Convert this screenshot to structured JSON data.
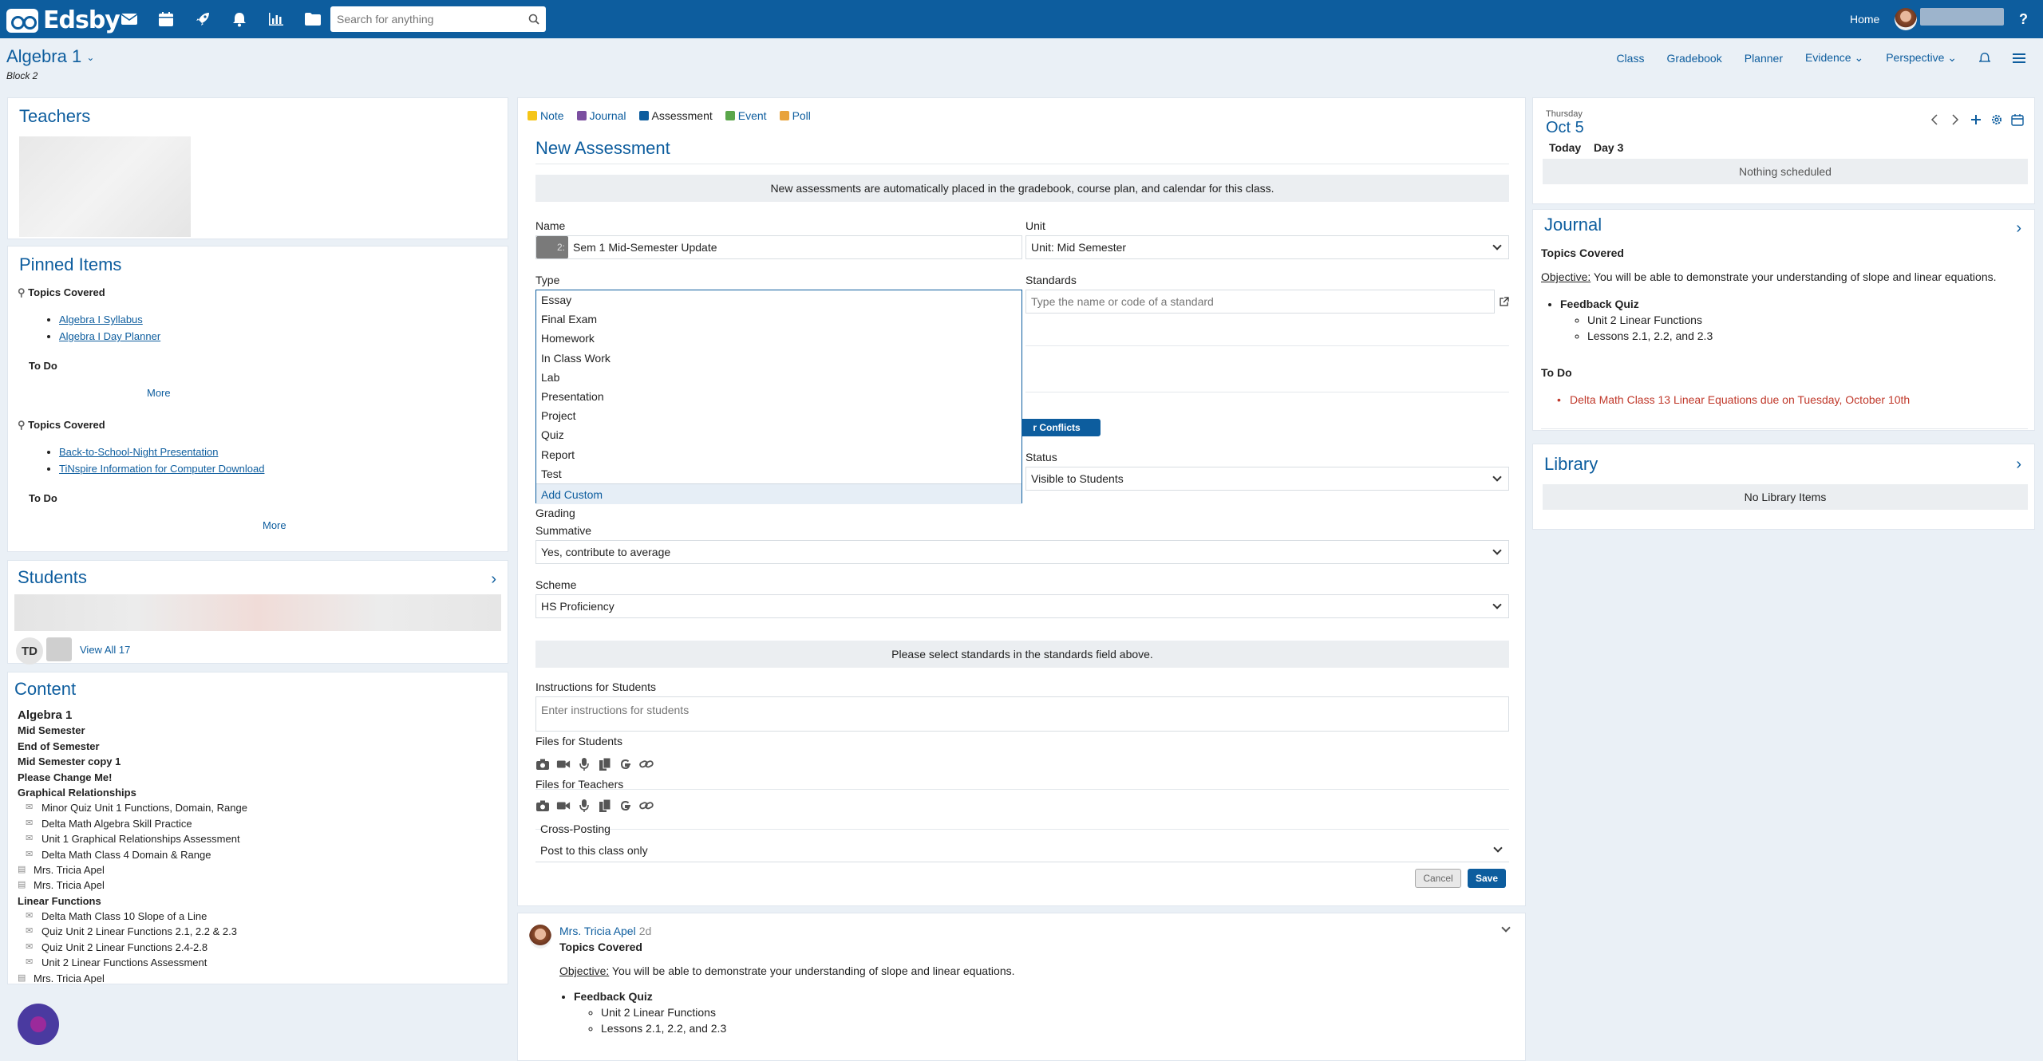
{
  "app": {
    "name": "Edsby"
  },
  "topbar": {
    "icons": [
      "mail-icon",
      "calendar-icon",
      "rocket-icon",
      "bell-icon",
      "chart-icon",
      "folder-icon"
    ],
    "search_placeholder": "Search for anything",
    "home_label": "Home",
    "help_label": "?"
  },
  "class": {
    "title": "Algebra 1",
    "block": "Block 2"
  },
  "classnav": {
    "class": "Class",
    "gradebook": "Gradebook",
    "planner": "Planner",
    "evidence": "Evidence",
    "perspective": "Perspective"
  },
  "teachers": {
    "title": "Teachers"
  },
  "pinned": {
    "title": "Pinned Items",
    "groups": [
      {
        "heading": "Topics Covered",
        "links": [
          "Algebra I Syllabus",
          "Algebra I Day Planner"
        ],
        "todo": "To Do",
        "more": "More"
      },
      {
        "heading": "Topics Covered",
        "links": [
          "Back-to-School-Night Presentation",
          "TiNspire Information for Computer Download"
        ],
        "todo": "To Do",
        "more": "More"
      }
    ]
  },
  "students": {
    "title": "Students",
    "badge": "TD",
    "view_all": "View All 17"
  },
  "content": {
    "title": "Content",
    "items": [
      {
        "text": "Algebra 1",
        "level": 0,
        "big": true
      },
      {
        "text": "Mid Semester",
        "level": 0
      },
      {
        "text": "End of Semester",
        "level": 0
      },
      {
        "text": "Mid Semester copy 1",
        "level": 0
      },
      {
        "text": "Please Change Me!",
        "level": 0
      },
      {
        "text": "Graphical Relationships",
        "level": 0
      },
      {
        "text": "Minor Quiz Unit 1 Functions, Domain, Range",
        "level": 2
      },
      {
        "text": "Delta Math Algebra Skill Practice",
        "level": 2
      },
      {
        "text": "Unit 1 Graphical Relationships Assessment",
        "level": 2
      },
      {
        "text": "Delta Math Class 4 Domain & Range",
        "level": 2
      },
      {
        "text": "Mrs. Tricia Apel",
        "level": 1
      },
      {
        "text": "Mrs. Tricia Apel",
        "level": 1
      },
      {
        "text": "Linear Functions",
        "level": 0
      },
      {
        "text": "Delta Math Class 10 Slope of a Line",
        "level": 2
      },
      {
        "text": "Quiz Unit 2 Linear Functions 2.1, 2.2 & 2.3",
        "level": 2
      },
      {
        "text": "Quiz Unit 2 Linear Functions 2.4-2.8",
        "level": 2
      },
      {
        "text": "Unit 2 Linear Functions Assessment",
        "level": 2
      },
      {
        "text": "Mrs. Tricia Apel",
        "level": 1
      }
    ]
  },
  "post_types": [
    {
      "label": "Note",
      "color": "#f5c518"
    },
    {
      "label": "Journal",
      "color": "#7b4fa0"
    },
    {
      "label": "Assessment",
      "color": "#0d5d9e",
      "active": true
    },
    {
      "label": "Event",
      "color": "#5aa64a"
    },
    {
      "label": "Poll",
      "color": "#e8a33c"
    }
  ],
  "form": {
    "title": "New Assessment",
    "info": "New assessments are automatically placed in the gradebook, course plan, and calendar for this class.",
    "name_label": "Name",
    "name_prefix": "2:",
    "name_value": "Sem 1 Mid-Semester Update",
    "unit_label": "Unit",
    "unit_value": "Unit: Mid Semester",
    "type_label": "Type",
    "type_options": [
      "Essay",
      "Final Exam",
      "Homework",
      "In Class Work",
      "Lab",
      "Presentation",
      "Project",
      "Quiz",
      "Report",
      "Test"
    ],
    "type_add_custom": "Add Custom",
    "standards_label": "Standards",
    "standards_placeholder": "Type the name or code of a standard",
    "conflicts_label": "r Conflicts",
    "status_label": "Status",
    "status_value": "Visible to Students",
    "grading_label": "Grading",
    "summative_label": "Summative",
    "summative_value": "Yes, contribute to average",
    "scheme_label": "Scheme",
    "scheme_value": "HS Proficiency",
    "standards_info": "Please select standards in the standards field above.",
    "instructions_label": "Instructions for Students",
    "instructions_placeholder": "Enter instructions for students",
    "files_students_label": "Files for Students",
    "files_teachers_label": "Files for Teachers",
    "file_icons": [
      "camera-icon",
      "video-icon",
      "microphone-icon",
      "copy-icon",
      "google-icon",
      "link-icon"
    ],
    "crossposting_label": "Cross-Posting",
    "crossposting_value": "Post to this class only",
    "cancel_label": "Cancel",
    "save_label": "Save"
  },
  "feed": {
    "author": "Mrs. Tricia Apel",
    "age": "2d",
    "title": "Topics Covered",
    "objective_label": "Objective:",
    "objective_text": " You will be able to demonstrate your understanding of slope and linear equations.",
    "item": "Feedback Quiz",
    "subitems": [
      "Unit 2 Linear Functions",
      "Lessons 2.1, 2.2, and 2.3"
    ]
  },
  "calendar": {
    "dow": "Thursday",
    "date": "Oct 5",
    "today": "Today",
    "day": "Day 3",
    "empty": "Nothing scheduled"
  },
  "journal": {
    "title": "Journal",
    "topics": "Topics Covered",
    "objective_label": "Objective:",
    "objective_text": " You will be able to demonstrate your understanding of slope and linear equations.",
    "item": "Feedback Quiz",
    "subitems": [
      "Unit 2 Linear Functions",
      "Lessons 2.1, 2.2, and 2.3"
    ],
    "todo": "To Do",
    "todo_item": "Delta Math Class 13 Linear Equations due on Tuesday, October 10th"
  },
  "library": {
    "title": "Library",
    "empty": "No Library Items"
  }
}
